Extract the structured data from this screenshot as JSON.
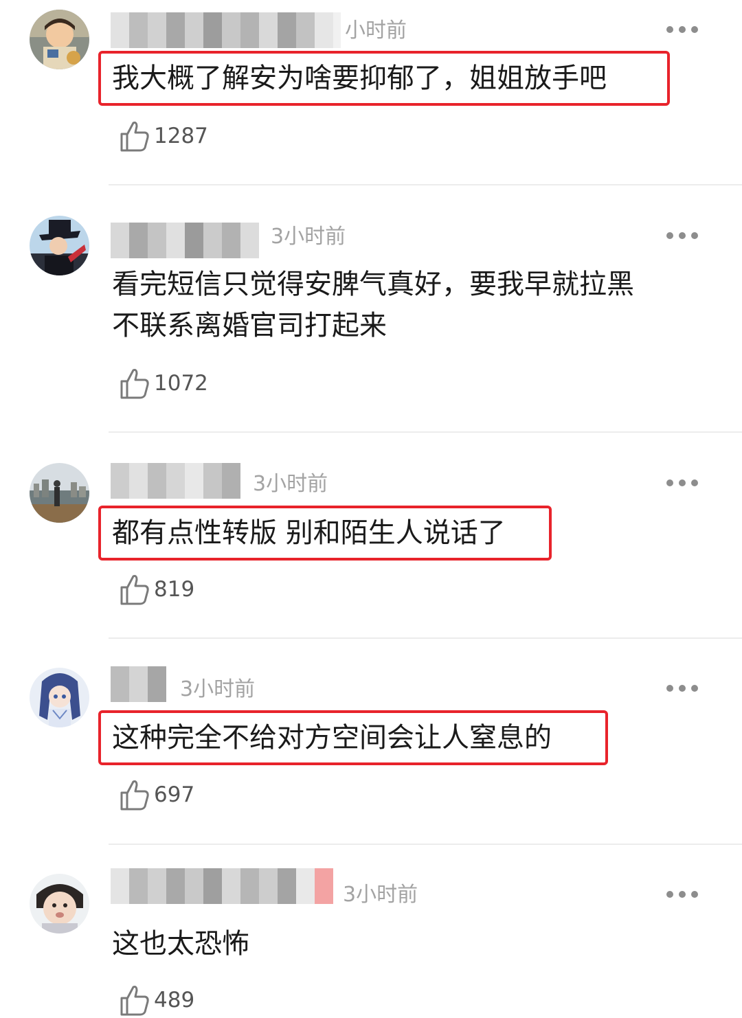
{
  "comments": [
    {
      "time": "小时前",
      "text_lines": [
        "我大概了解安为啥要抑郁了，姐姐放手吧"
      ],
      "highlighted": true,
      "likes": "1287",
      "avatar_icon": "child-avatar-icon"
    },
    {
      "time": "3小时前",
      "text_lines": [
        "看完短信只觉得安脾气真好，要我早就拉黑",
        "不联系离婚官司打起来"
      ],
      "highlighted": false,
      "likes": "1072",
      "avatar_icon": "hat-person-avatar-icon"
    },
    {
      "time": "3小时前",
      "text_lines": [
        "都有点性转版 别和陌生人说话了"
      ],
      "highlighted": true,
      "likes": "819",
      "avatar_icon": "cityscape-avatar-icon"
    },
    {
      "time": "3小时前",
      "text_lines": [
        "这种完全不给对方空间会让人窒息的"
      ],
      "highlighted": true,
      "likes": "697",
      "avatar_icon": "anime-character-avatar-icon"
    },
    {
      "time": "3小时前",
      "text_lines": [
        "这也太恐怖"
      ],
      "highlighted": false,
      "likes": "489",
      "avatar_icon": "baby-avatar-icon"
    }
  ],
  "colors": {
    "highlight_border": "#e8232b",
    "time_text": "#a3a3a3",
    "like_count": "#555555",
    "divider": "#ececec"
  },
  "icons": {
    "like": "thumbs-up-icon",
    "more": "more-dots-icon"
  }
}
